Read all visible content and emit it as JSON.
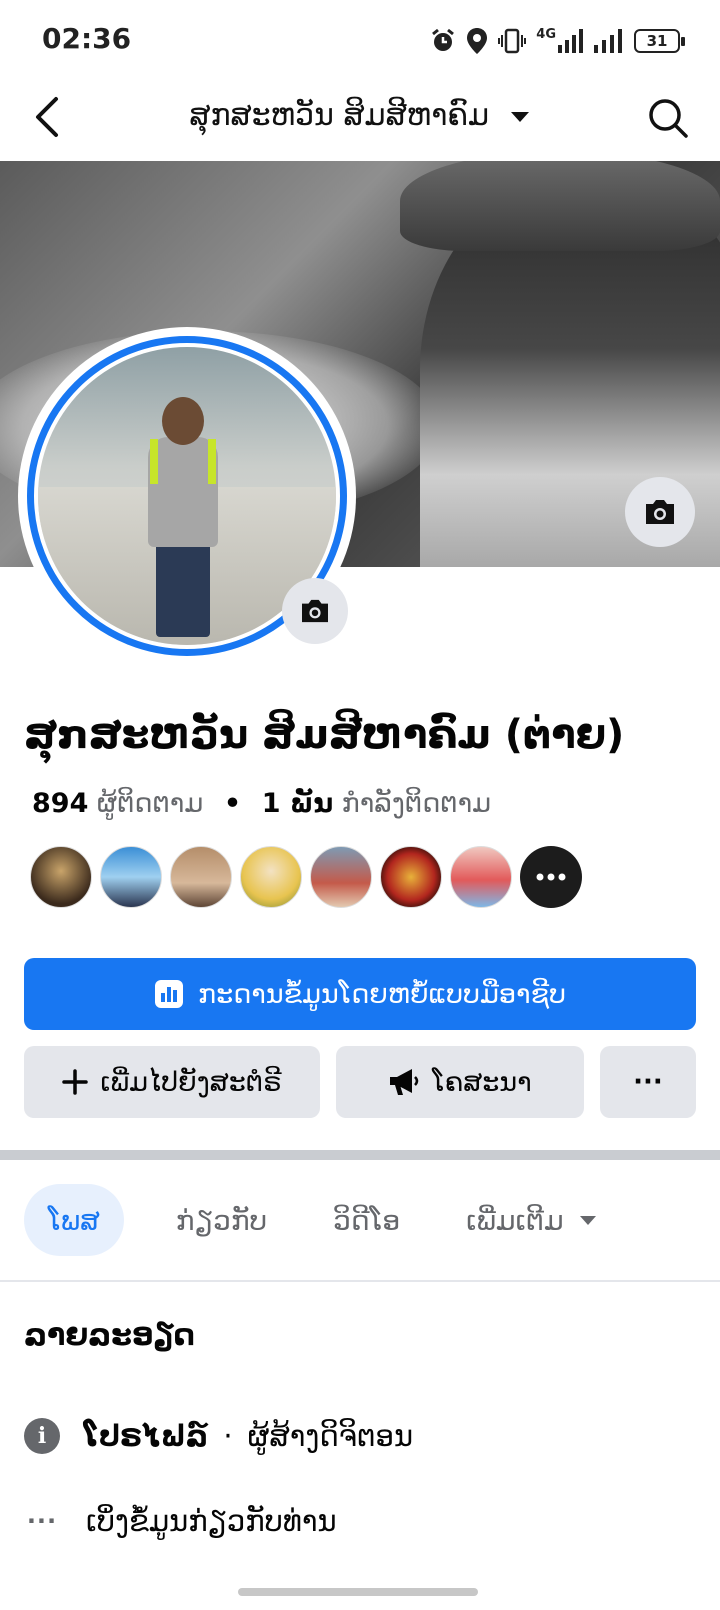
{
  "status_bar": {
    "time": "02:36",
    "network": "4G",
    "battery": "31",
    "icons": [
      "alarm-icon",
      "location-icon",
      "vibrate-icon",
      "signal-icon",
      "signal-icon",
      "battery-icon"
    ]
  },
  "header": {
    "title": "ສຸກສະຫວັນ ສິມສີຫາຄົມ",
    "icons": [
      "back-arrow-icon",
      "dropdown-caret-icon",
      "search-icon"
    ]
  },
  "profile": {
    "name": "ສຸກສະຫວັນ ສິມສີຫາຄົມ (ຕ່າຍ)",
    "followers_count": "894",
    "followers_label": "ຜູ້ຕິດຕາມ",
    "separator": "•",
    "following_count": "1 ພັນ",
    "following_label": "ກໍາລັງຕິດຕາມ"
  },
  "friends": {
    "visible_count": 7,
    "more_icon": "ellipsis-icon"
  },
  "actions": {
    "dashboard_label": "ກະດານຂໍ້ມູນໂດຍຫຍໍ້ແບບມືອາຊີບ",
    "add_story_label": "ເພີ່ມໄປຍັງສະຕໍຣີ",
    "promote_label": "ໂຄສະນາ",
    "more_label": "···"
  },
  "tabs": [
    {
      "label": "ໂພສ",
      "active": true
    },
    {
      "label": "ກ່ຽວກັບ",
      "active": false
    },
    {
      "label": "ວິດີໂອ",
      "active": false
    },
    {
      "label": "ເພີ່ມເຕີມ",
      "active": false
    }
  ],
  "details": {
    "title": "ລາຍລະອຽດ",
    "profile_type": "ໂປຣໄຟລ໌",
    "dot": "·",
    "profile_category": "ຜູ້ສ້າງດິຈິຕອນ",
    "about_link": "ເບິ່ງຂໍ້ມູນກ່ຽວກັບທ່ານ"
  },
  "colors": {
    "accent": "#1877f2",
    "secondary_button": "#e4e6eb",
    "text_secondary": "#65676b",
    "active_tab_bg": "#e7f0fd"
  }
}
